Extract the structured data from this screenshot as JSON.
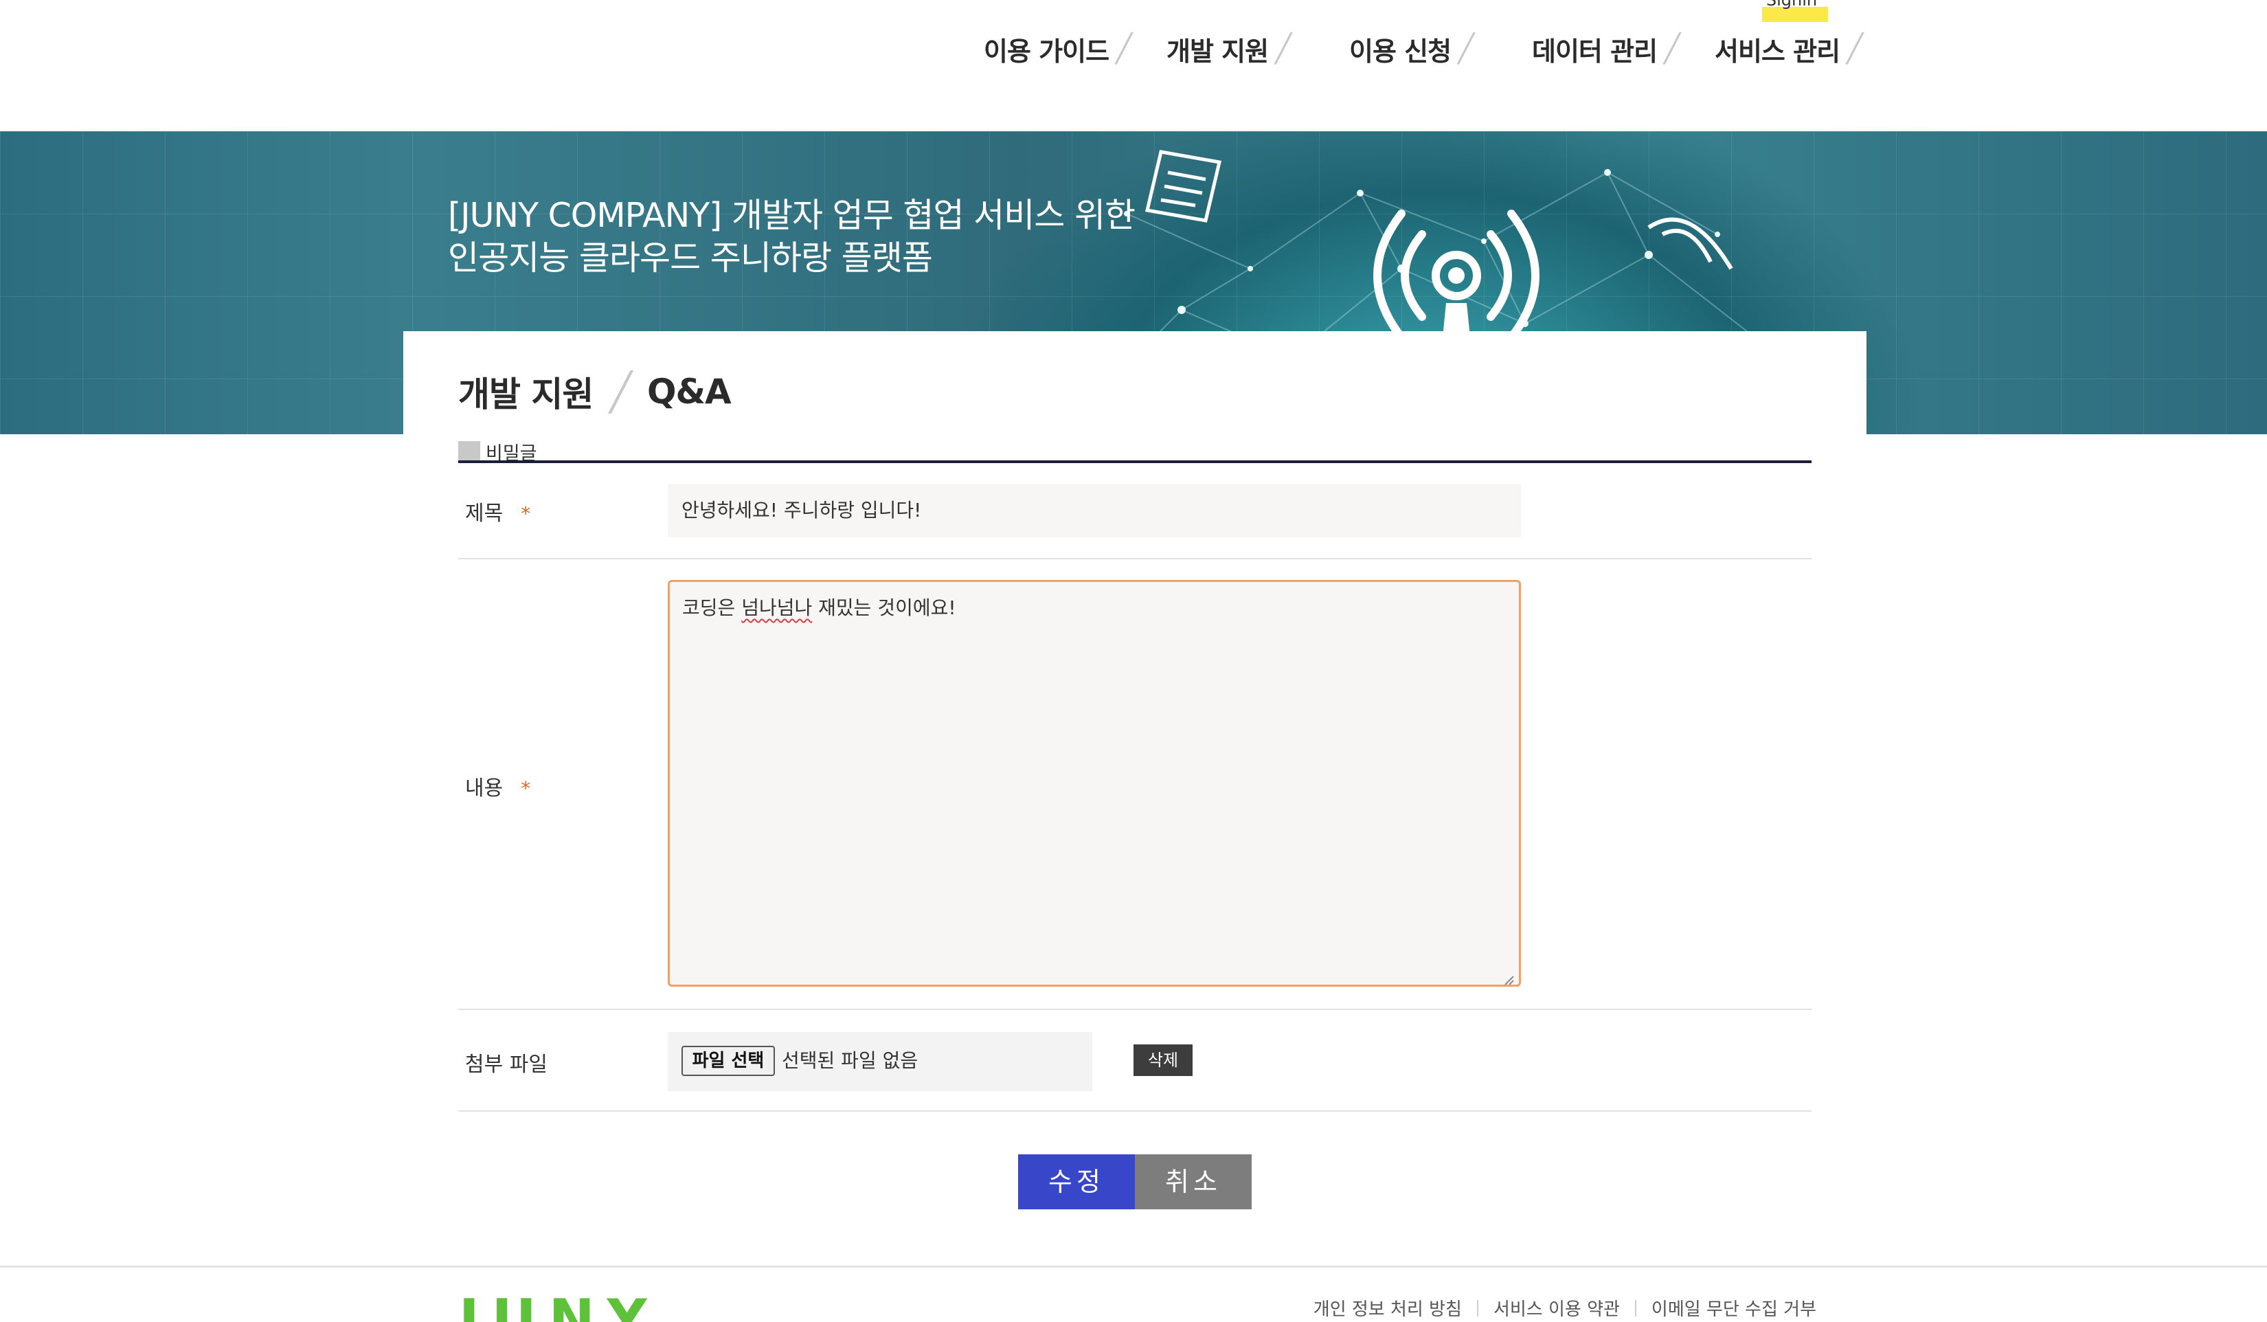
{
  "header": {
    "signin_label": "Signin",
    "nav": [
      {
        "label": "이용 가이드"
      },
      {
        "label": "개발 지원"
      },
      {
        "label": "이용 신청"
      },
      {
        "label": "데이터 관리"
      },
      {
        "label": "서비스 관리"
      }
    ],
    "separator": "╱"
  },
  "banner": {
    "line1": "[JUNY COMPANY] 개발자 업무 협업 서비스 위한",
    "line2": "인공지능 클라우드 주니하랑 플랫폼"
  },
  "breadcrumb": {
    "main": "개발 지원",
    "sub": "Q&A"
  },
  "form": {
    "secret_label": "비밀글",
    "title_label": "제목",
    "required_mark": "*",
    "title_value": "안녕하세요! 주니하랑 입니다!",
    "content_label": "내용",
    "content_value_prefix": "코딩은 ",
    "content_value_misspelled": "넘나넘나",
    "content_value_suffix": " 재밌는 것이에요!",
    "attachment_label": "첨부 파일",
    "file_button_label": "파일 선택",
    "file_none_text": "선택된 파일 없음",
    "delete_label": "삭제",
    "submit_label": "수정",
    "cancel_label": "취소"
  },
  "footer": {
    "logo_text": "JUNY",
    "links": [
      {
        "label": "개인 정보 처리 방침"
      },
      {
        "label": "서비스 이용 약관"
      },
      {
        "label": "이메일 무단 수집 거부"
      }
    ]
  },
  "colors": {
    "accent_blue": "#3847c9",
    "cancel_gray": "#7d7d7d",
    "required_orange": "#e06820",
    "focus_border": "#f2a06a",
    "logo_green": "#5ec13a",
    "signin_highlight": "#fbe94a"
  }
}
